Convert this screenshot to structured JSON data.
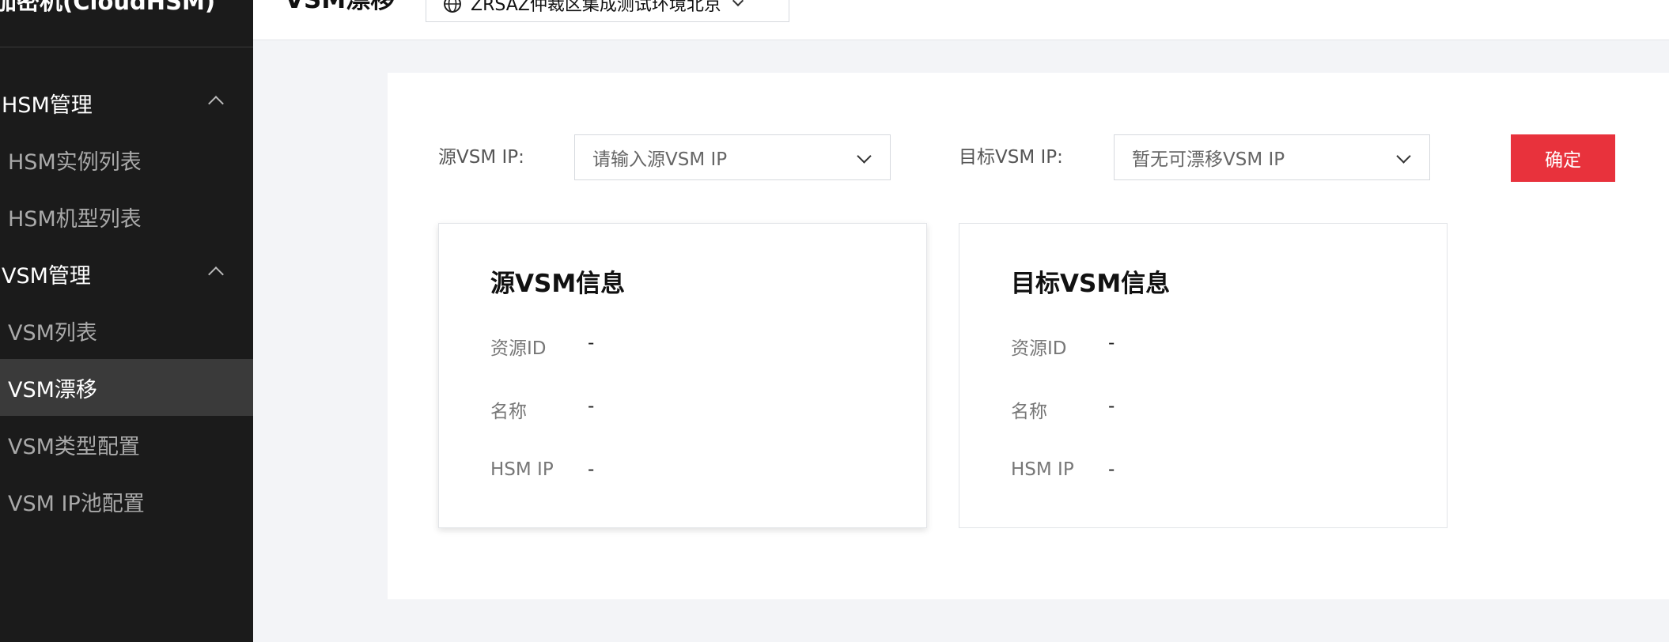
{
  "sidebar": {
    "title": "加密机(CloudHSM)",
    "groups": [
      {
        "label": "HSM管理",
        "items": [
          {
            "label": "HSM实例列表"
          },
          {
            "label": "HSM机型列表"
          }
        ]
      },
      {
        "label": "VSM管理",
        "items": [
          {
            "label": "VSM列表"
          },
          {
            "label": "VSM漂移",
            "active": true
          },
          {
            "label": "VSM类型配置"
          },
          {
            "label": "VSM IP池配置"
          }
        ]
      }
    ]
  },
  "header": {
    "title": "VSM漂移",
    "region": "ZRSAZ仲裁区集成测试环境北京"
  },
  "form": {
    "source_label": "源VSM IP:",
    "source_placeholder": "请输入源VSM IP",
    "target_label": "目标VSM IP:",
    "target_placeholder": "暂无可漂移VSM IP",
    "confirm_label": "确定"
  },
  "cards": {
    "source": {
      "title": "源VSM信息",
      "rows": [
        {
          "label": "资源ID",
          "value": "-"
        },
        {
          "label": "名称",
          "value": "-"
        },
        {
          "label": "HSM IP",
          "value": "-"
        }
      ]
    },
    "target": {
      "title": "目标VSM信息",
      "rows": [
        {
          "label": "资源ID",
          "value": "-"
        },
        {
          "label": "名称",
          "value": "-"
        },
        {
          "label": "HSM IP",
          "value": "-"
        }
      ]
    }
  },
  "colors": {
    "sidebar_bg": "#1b1b1b",
    "active_item_bg": "#3a3a3a",
    "primary_button": "#e8323c",
    "page_bg": "#f3f4f7"
  }
}
